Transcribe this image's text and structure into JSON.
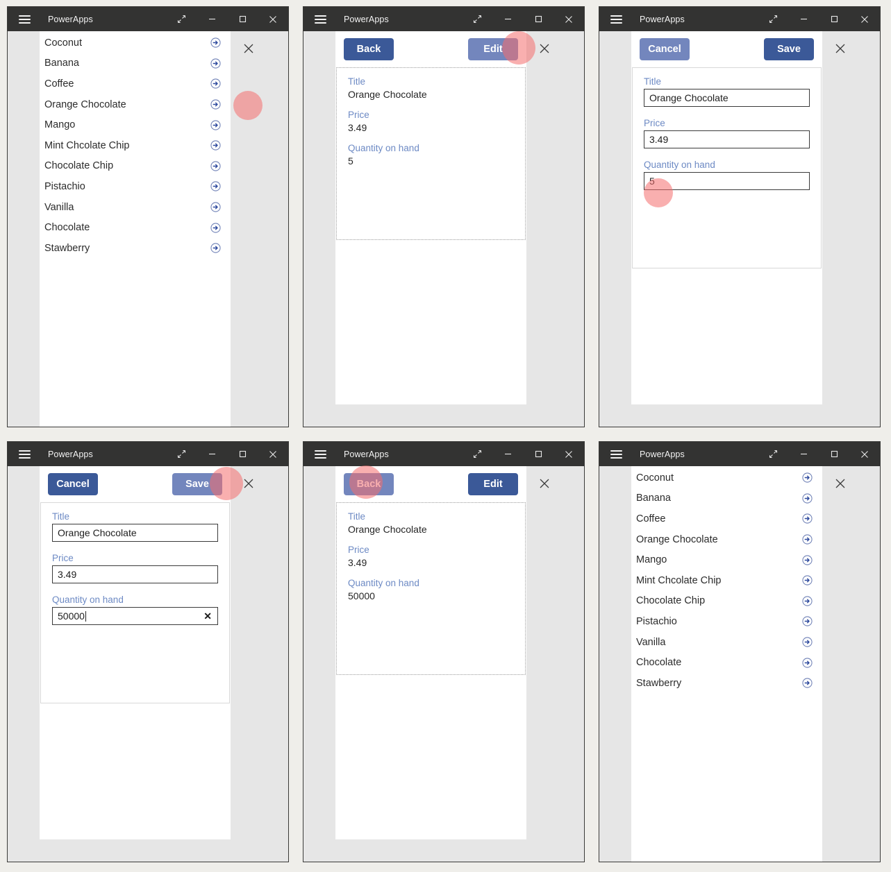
{
  "window": {
    "app_title": "PowerApps",
    "controls": {
      "menu": "hamburger-menu-icon",
      "restore": "expand-icon",
      "minimize": "minimize-icon",
      "maximize": "maximize-icon",
      "close": "close-icon"
    }
  },
  "colors": {
    "page_background": "#efeeea",
    "titlebar": "#333332",
    "window_chrome": "#e6e6e6",
    "canvas": "#ffffff",
    "primary_button": "#3b5998",
    "primary_button_hover": "#7386bd",
    "field_label": "#6d8ac4",
    "arrow_icon": "#3b5998",
    "highlight_blob": "#f46e6e"
  },
  "browse_screen": {
    "items": [
      "Coconut",
      "Banana",
      "Coffee",
      "Orange Chocolate",
      "Mango",
      "Mint Chcolate Chip",
      "Chocolate Chip",
      "Pistachio",
      "Vanilla",
      "Chocolate",
      "Stawberry"
    ],
    "row_icon": "arrow-right-circle-icon",
    "close_icon": "close-icon"
  },
  "detail_screen": {
    "back_label": "Back",
    "edit_label": "Edit",
    "fields": [
      {
        "label": "Title",
        "value": "Orange Chocolate"
      },
      {
        "label": "Price",
        "value": "3.49"
      },
      {
        "label": "Quantity on hand",
        "value": "5"
      }
    ]
  },
  "detail_screen_after": {
    "back_label": "Back",
    "edit_label": "Edit",
    "fields": [
      {
        "label": "Title",
        "value": "Orange Chocolate"
      },
      {
        "label": "Price",
        "value": "3.49"
      },
      {
        "label": "Quantity on hand",
        "value": "50000"
      }
    ]
  },
  "edit_screen": {
    "cancel_label": "Cancel",
    "save_label": "Save",
    "fields": [
      {
        "label": "Title",
        "value": "Orange Chocolate"
      },
      {
        "label": "Price",
        "value": "3.49"
      },
      {
        "label": "Quantity on hand",
        "value": "5"
      }
    ]
  },
  "edit_screen_typed": {
    "cancel_label": "Cancel",
    "save_label": "Save",
    "clear_icon": "clear-x-icon",
    "fields": [
      {
        "label": "Title",
        "value": "Orange Chocolate"
      },
      {
        "label": "Price",
        "value": "3.49"
      },
      {
        "label": "Quantity on hand",
        "value": "50000"
      }
    ]
  },
  "panels": [
    {
      "index": 1,
      "name": "browse-gallery",
      "action_target": "row-arrow-orange-chocolate"
    },
    {
      "index": 2,
      "name": "detail-view",
      "action_target": "edit-button"
    },
    {
      "index": 3,
      "name": "edit-form",
      "action_target": "quantity-input"
    },
    {
      "index": 4,
      "name": "edit-form-typed",
      "action_target": "save-button"
    },
    {
      "index": 5,
      "name": "detail-view-updated",
      "action_target": "back-button"
    },
    {
      "index": 6,
      "name": "browse-gallery-final",
      "action_target": "none"
    }
  ]
}
